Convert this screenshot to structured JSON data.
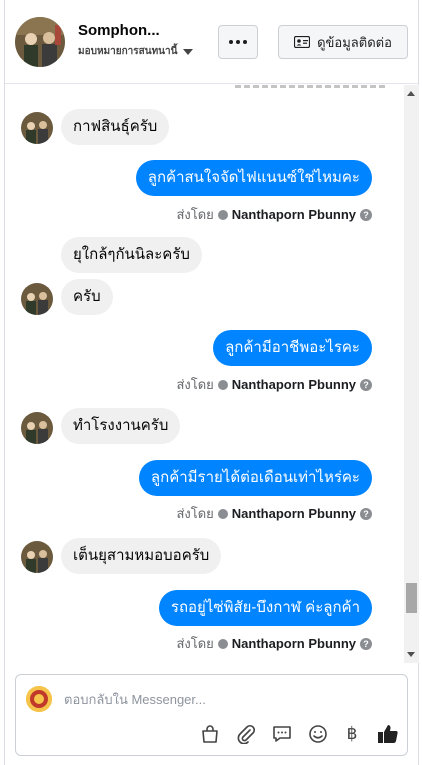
{
  "header": {
    "contact_name": "Somphon...",
    "assign_label": "มอบหมายการสนทนานี้",
    "contact_info_button": "ดูข้อมูลติดต่อ"
  },
  "messages": [
    {
      "dir": "in",
      "text": "กาฟสินธุ์ครับ"
    },
    {
      "dir": "out",
      "text": "ลูกค้าสนใจจัดไฟแนนซ์ใช่ไหมคะ",
      "sent_by_label": "ส่งโดย",
      "sender": "Nanthaporn Pbunny"
    },
    {
      "dir": "in",
      "text": "ยุใกล้ๆกันนิละครับ"
    },
    {
      "dir": "in",
      "text": "ครับ"
    },
    {
      "dir": "out",
      "text": "ลูกค้ามีอาชีพอะไรคะ",
      "sent_by_label": "ส่งโดย",
      "sender": "Nanthaporn Pbunny"
    },
    {
      "dir": "in",
      "text": "ทำโรงงานครับ"
    },
    {
      "dir": "out",
      "text": "ลูกค้ามีรายได้ต่อเดือนเท่าไหร่คะ",
      "sent_by_label": "ส่งโดย",
      "sender": "Nanthaporn Pbunny"
    },
    {
      "dir": "in",
      "text": "เต็นยุสามหมอบอครับ"
    },
    {
      "dir": "out",
      "text": "รถอยู่ไซ่พิสัย-บึงกาฬ ค่ะลูกค้า",
      "sent_by_label": "ส่งโดย",
      "sender": "Nanthaporn Pbunny"
    }
  ],
  "composer": {
    "placeholder": "ตอบกลับใน Messenger...",
    "baht_symbol": "฿"
  },
  "colors": {
    "outgoing_bubble": "#0084ff",
    "incoming_bubble": "#f0f0f0"
  }
}
